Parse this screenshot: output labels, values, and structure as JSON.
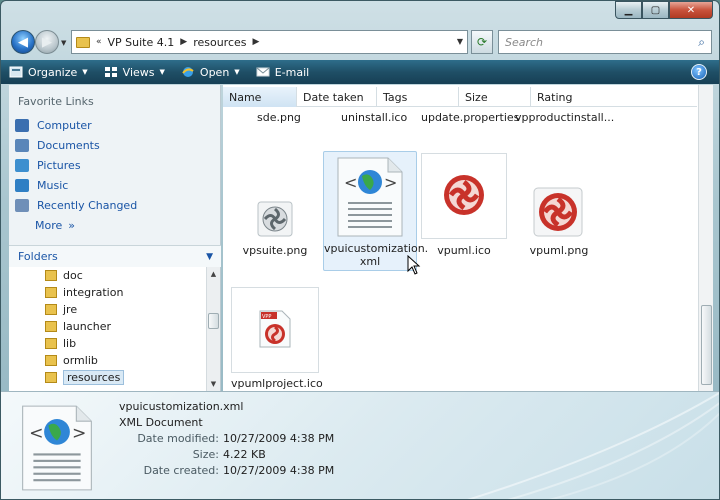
{
  "window": {
    "caption_buttons": [
      "minimize",
      "maximize",
      "close"
    ]
  },
  "address_bar": {
    "crumbs": [
      "VP Suite 4.1",
      "resources"
    ],
    "search_placeholder": "Search"
  },
  "toolbar": {
    "organize": "Organize",
    "views": "Views",
    "open": "Open",
    "email": "E-mail",
    "help": "?"
  },
  "nav": {
    "favorite_links_title": "Favorite Links",
    "favorites": [
      {
        "label": "Computer",
        "icon": "computer-icon",
        "color": "#3b6fb0"
      },
      {
        "label": "Documents",
        "icon": "documents-icon",
        "color": "#5a86b9"
      },
      {
        "label": "Pictures",
        "icon": "pictures-icon",
        "color": "#3d8fcf"
      },
      {
        "label": "Music",
        "icon": "music-icon",
        "color": "#2f7fc4"
      },
      {
        "label": "Recently Changed",
        "icon": "recent-icon",
        "color": "#6f8fb8"
      }
    ],
    "more": "More",
    "folders_title": "Folders",
    "tree": [
      "doc",
      "integration",
      "jre",
      "launcher",
      "lib",
      "ormlib",
      "resources"
    ],
    "selected_tree": "resources"
  },
  "files": {
    "columns": [
      "Name",
      "Date taken",
      "Tags",
      "Size",
      "Rating"
    ],
    "top_row": [
      "sde.png",
      "uninstall.ico",
      "update.properties",
      "vpproductinstall..."
    ],
    "tiles": [
      {
        "label": "vpsuite.png"
      },
      {
        "label": "vpuicustomization.",
        "label2": "xml"
      },
      {
        "label": "vpuml.ico"
      },
      {
        "label": "vpuml.png"
      },
      {
        "label": "vpumlproject.ico"
      }
    ]
  },
  "details": {
    "filename": "vpuicustomization.xml",
    "type": "XML Document",
    "rows": [
      {
        "key": "Date modified:",
        "value": "10/27/2009 4:38 PM"
      },
      {
        "key": "Size:",
        "value": "4.22 KB"
      },
      {
        "key": "Date created:",
        "value": "10/27/2009 4:38 PM"
      }
    ]
  }
}
